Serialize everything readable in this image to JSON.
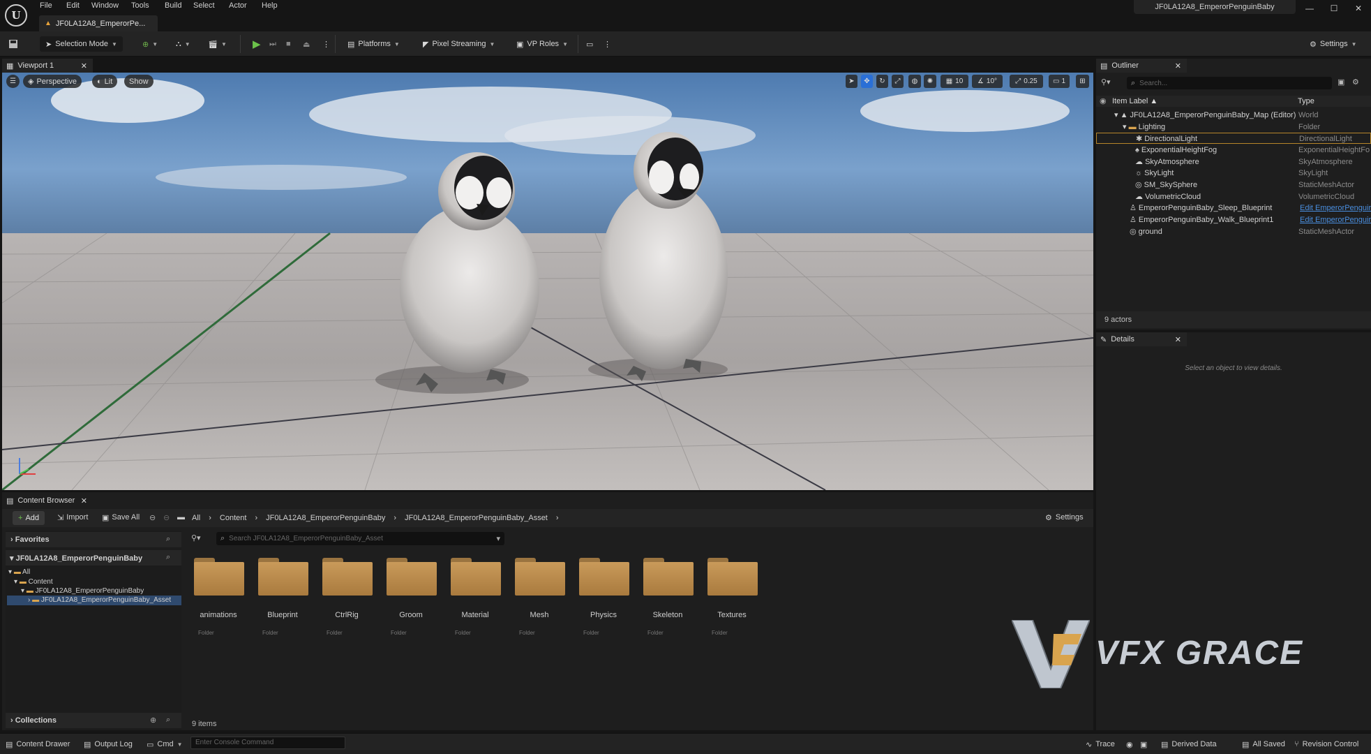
{
  "menu": [
    "File",
    "Edit",
    "Window",
    "Tools",
    "Build",
    "Select",
    "Actor",
    "Help"
  ],
  "document_tab": "JF0LA12A8_EmperorPe...",
  "project_name": "JF0LA12A8_EmperorPenguinBaby",
  "toolbar": {
    "selection_mode": "Selection Mode",
    "platforms": "Platforms",
    "pixel_streaming": "Pixel Streaming",
    "vp_roles": "VP Roles",
    "settings": "Settings"
  },
  "viewport": {
    "tab": "Viewport 1",
    "perspective": "Perspective",
    "lit": "Lit",
    "show": "Show",
    "grid_snap": "10",
    "rot_snap": "10°",
    "scale_snap": "0.25",
    "camera_speed": "1"
  },
  "outliner": {
    "tab": "Outliner",
    "search_placeholder": "Search...",
    "col_label": "Item Label",
    "col_type": "Type",
    "rows": [
      {
        "label": "JF0LA12A8_EmperorPenguinBaby_Map (Editor)",
        "type": "World"
      },
      {
        "label": "Lighting",
        "type": "Folder"
      },
      {
        "label": "DirectionalLight",
        "type": "DirectionalLight"
      },
      {
        "label": "ExponentialHeightFog",
        "type": "ExponentialHeightFo"
      },
      {
        "label": "SkyAtmosphere",
        "type": "SkyAtmosphere"
      },
      {
        "label": "SkyLight",
        "type": "SkyLight"
      },
      {
        "label": "SM_SkySphere",
        "type": "StaticMeshActor"
      },
      {
        "label": "VolumetricCloud",
        "type": "VolumetricCloud"
      },
      {
        "label": "EmperorPenguinBaby_Sleep_Blueprint",
        "type": "Edit EmperorPenguir"
      },
      {
        "label": "EmperorPenguinBaby_Walk_Blueprint1",
        "type": "Edit EmperorPenguir"
      },
      {
        "label": "ground",
        "type": "StaticMeshActor"
      }
    ],
    "actor_count": "9 actors"
  },
  "details": {
    "tab": "Details",
    "empty": "Select an object to view details."
  },
  "content_browser": {
    "tab": "Content Browser",
    "add": "Add",
    "import": "Import",
    "save_all": "Save All",
    "breadcrumb": [
      "All",
      "Content",
      "JF0LA12A8_EmperorPenguinBaby",
      "JF0LA12A8_EmperorPenguinBaby_Asset"
    ],
    "settings": "Settings",
    "favorites": "Favorites",
    "root": "JF0LA12A8_EmperorPenguinBaby",
    "tree": [
      "All",
      "Content",
      "JF0LA12A8_EmperorPenguinBaby",
      "JF0LA12A8_EmperorPenguinBaby_Asset"
    ],
    "search_placeholder": "Search JF0LA12A8_EmperorPenguinBaby_Asset",
    "folders": [
      "animations",
      "Blueprint",
      "CtrlRig",
      "Groom",
      "Material",
      "Mesh",
      "Physics",
      "Skeleton",
      "Textures"
    ],
    "folder_type": "Folder",
    "collections": "Collections",
    "item_count": "9 items"
  },
  "watermark": "VFX GRACE",
  "statusbar": {
    "content_drawer": "Content Drawer",
    "output_log": "Output Log",
    "cmd": "Cmd",
    "console_placeholder": "Enter Console Command",
    "trace": "Trace",
    "derived_data": "Derived Data",
    "all_saved": "All Saved",
    "revision_control": "Revision Control"
  }
}
